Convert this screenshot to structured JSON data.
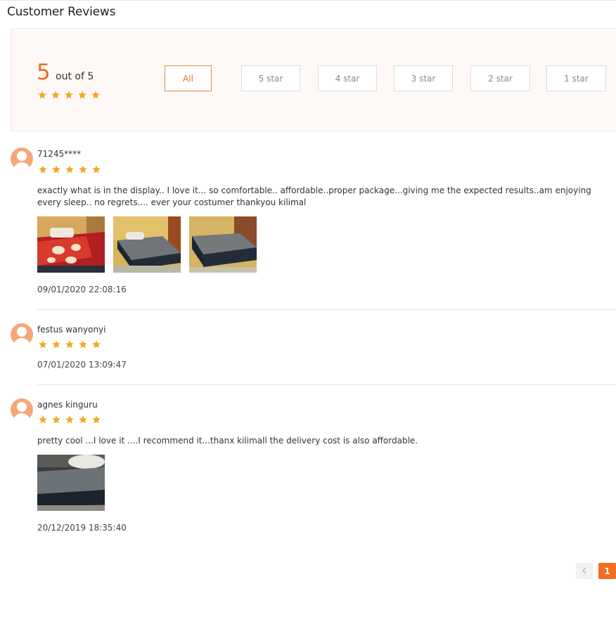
{
  "section": {
    "title": "Customer Reviews"
  },
  "summary": {
    "score": "5",
    "score_suffix": "out of 5",
    "rating": 5,
    "filters": [
      {
        "label": "All",
        "active": true
      },
      {
        "label": "5 star",
        "active": false
      },
      {
        "label": "4 star",
        "active": false
      },
      {
        "label": "3 star",
        "active": false
      },
      {
        "label": "2 star",
        "active": false
      },
      {
        "label": "1 star",
        "active": false
      }
    ]
  },
  "reviews": [
    {
      "username": "71245****",
      "rating": 5,
      "text": "exactly what is in the display.. I love it... so comfortable.. affordable..proper package...giving me the expected results..am enjoying every sleep.. no regrets.... ever your costumer thankyou kilimal",
      "photos": [
        "photo-bed-red-blanket",
        "photo-bed-gray-air-mattress",
        "photo-bed-gray-air-mattress"
      ],
      "timestamp": "09/01/2020 22:08:16"
    },
    {
      "username": "festus wanyonyi",
      "rating": 5,
      "text": "",
      "photos": [],
      "timestamp": "07/01/2020 13:09:47"
    },
    {
      "username": "agnes kinguru",
      "rating": 5,
      "text": "pretty cool ...I love it ....I recommend it...thanx kilimall the delivery cost is also affordable.",
      "photos": [
        "photo-bed-gray-air-mattress"
      ],
      "timestamp": "20/12/2019 18:35:40"
    }
  ],
  "pagination": {
    "prev_icon": "chevron-left-icon",
    "current_page": "1"
  },
  "colors": {
    "accent": "#f36d21",
    "star": "#f5a623",
    "summary_bg": "#fef9f6"
  }
}
